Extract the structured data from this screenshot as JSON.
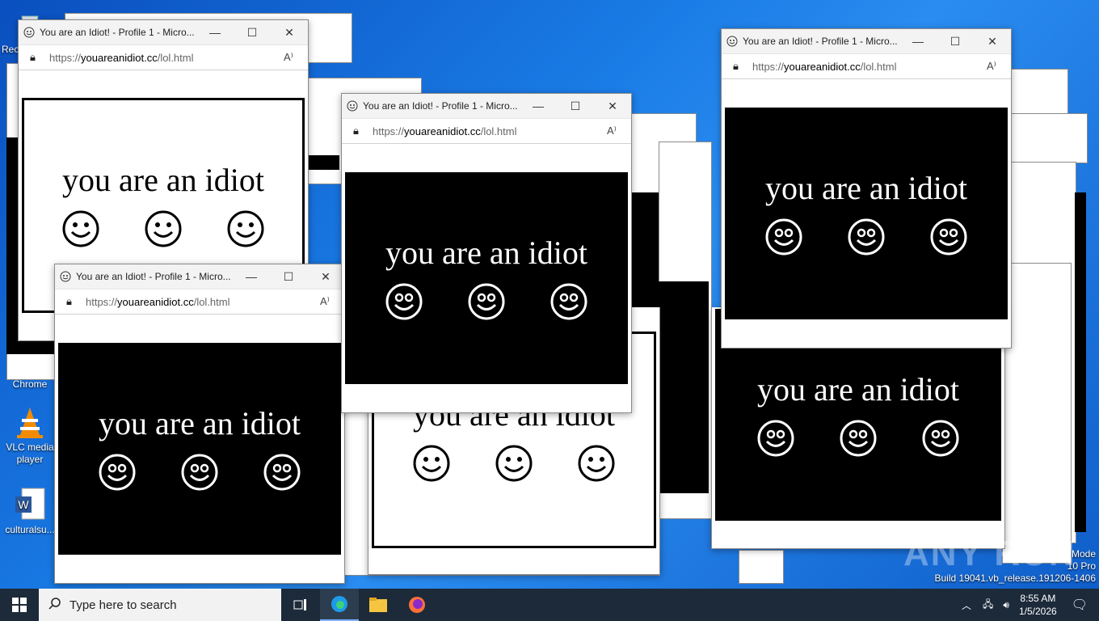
{
  "desktop": {
    "icons": [
      {
        "label": "Rec"
      },
      {
        "label": "Chrome"
      },
      {
        "label": "VLC media player"
      },
      {
        "label": "culturalsu..."
      }
    ],
    "watermark_mode": "Mode",
    "watermark_edition": "10 Pro",
    "watermark_build": "Build 19041.vb_release.191206-1406",
    "anyrun": "ANY RUN"
  },
  "popup": {
    "title": "You are an Idiot! - Profile 1 - Micro...",
    "url_prefix": "https://",
    "url_domain": "youareanidiot.cc",
    "url_path": "/lol.html",
    "message": "you are an idiot",
    "read_aloud_icon": "A⁾",
    "minimize": "—",
    "maximize": "☐",
    "close": "✕"
  },
  "taskbar": {
    "search_placeholder": "Type here to search",
    "time": "8:55 AM",
    "date": "1/5/2026",
    "apps": [
      "task-view-icon",
      "edge-icon",
      "file-explorer-icon",
      "firefox-icon"
    ]
  }
}
